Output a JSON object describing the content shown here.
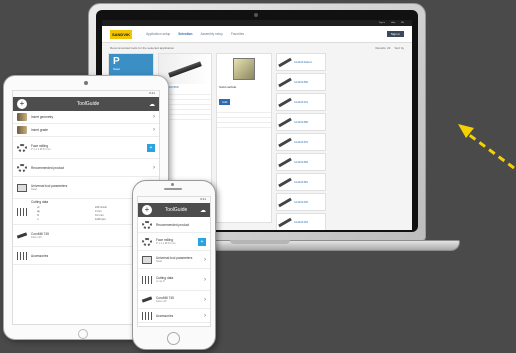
{
  "app": {
    "title": "ToolGuide",
    "add_icon": "plus-icon",
    "cloud_icon": "cloud-icon",
    "status_time": "9:41"
  },
  "laptop": {
    "brand": "SANDVIK",
    "topbar_links": [
      "Sign in",
      "Help",
      "EN"
    ],
    "tabs": [
      "Application setup",
      "Selection",
      "Assembly setup",
      "Favorites"
    ],
    "login_label": "Sign in",
    "breadcrumb": "Recommended tools for the selected application",
    "results_count": "Results: 24",
    "sort_label": "Sort by",
    "col1_label": "P",
    "col1_sub": "Steel",
    "col2_title": "CoroDrill 860",
    "col3_title": "Solid carbide",
    "badge_label": "Add",
    "mini_cards": [
      "CoroDrill Delta-C",
      "CoroDrill 860",
      "CoroDrill 461",
      "CoroDrill 880",
      "CoroDrill 870",
      "CoroDrill 862",
      "CoroDrill 881",
      "CoroDrill 460",
      "CoroDrill 452"
    ]
  },
  "tablet": {
    "items": [
      {
        "label": "Insert geometry",
        "sub": "",
        "icon": "insert-icon",
        "trail": "›"
      },
      {
        "label": "Insert grade",
        "sub": "",
        "icon": "insert-icon",
        "trail": "›"
      },
      {
        "label": "Face milling",
        "sub": "P 1.1.1 Ø 63 mm",
        "icon": "gear-icon",
        "trail": "+"
      },
      {
        "label": "Recommended product",
        "sub": "",
        "icon": "gear-icon",
        "trail": "›"
      },
      {
        "label": "Universal tool parameters",
        "sub": "Steel",
        "icon": "machine-icon",
        "trail": "›"
      },
      {
        "label": "Cutting data",
        "sub": "vc  ap  fz",
        "icon": "grid-icon",
        "trail": "›"
      },
      {
        "label": "CoroMill 745",
        "sub": "Face mill",
        "icon": "tool-icon",
        "trail": "›"
      },
      {
        "label": "Accessories",
        "sub": "",
        "icon": "grid-icon",
        "trail": "›"
      }
    ],
    "params": [
      "vc",
      "220 m/min",
      "ap",
      "3 mm",
      "fz",
      "0.2 mm",
      "n",
      "1100 rpm"
    ]
  },
  "phone": {
    "items": [
      {
        "label": "Recommended product",
        "sub": "",
        "icon": "gear-icon",
        "trail": "›"
      },
      {
        "label": "Face milling",
        "sub": "P 1.1.1 Ø 63 mm",
        "icon": "gear-icon",
        "trail": "+"
      },
      {
        "label": "Universal tool parameters",
        "sub": "Steel",
        "icon": "machine-icon",
        "trail": "›"
      },
      {
        "label": "Cutting data",
        "sub": "vc  ap  fz",
        "icon": "grid-icon",
        "trail": "›"
      },
      {
        "label": "CoroMill 745",
        "sub": "Face mill",
        "icon": "tool-icon",
        "trail": "›"
      },
      {
        "label": "Accessories",
        "sub": "",
        "icon": "grid-icon",
        "trail": "›"
      }
    ]
  },
  "colors": {
    "accent": "#29a3e0",
    "header": "#4d4d4d",
    "brand": "#f2c500",
    "arrow": "#f2d200"
  }
}
